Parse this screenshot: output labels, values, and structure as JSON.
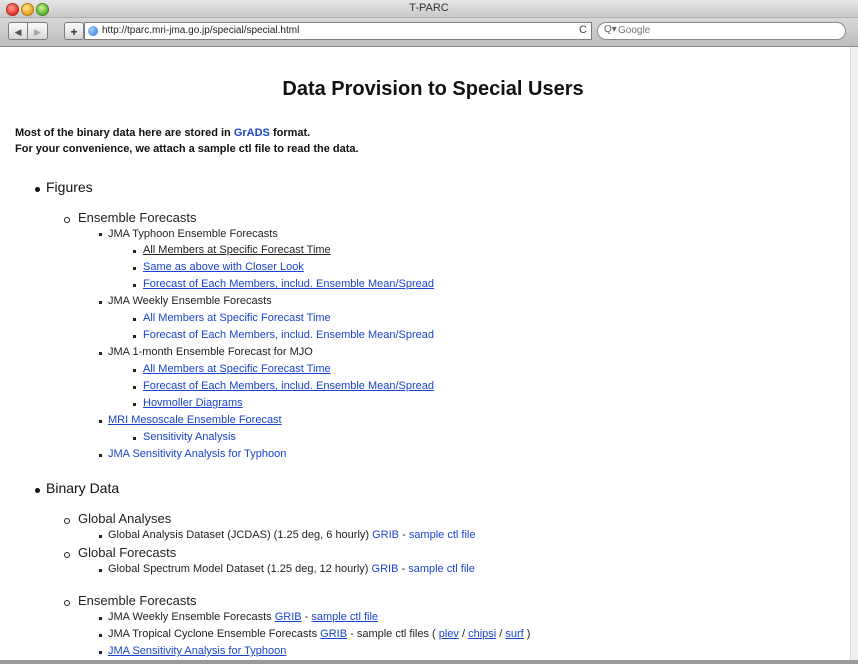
{
  "window": {
    "title": "T-PARC"
  },
  "toolbar": {
    "back_glyph": "◀",
    "forward_glyph": "▶",
    "add_glyph": "+",
    "url": "http://tparc.mri-jma.go.jp/special/special.html",
    "reload_glyph": "C",
    "search_placeholder": "Google",
    "search_glyph": "Q▾"
  },
  "page": {
    "title": "Data Provision to Special Users",
    "intro_pre": "Most of the binary data here are stored in ",
    "intro_link": "GrADS",
    "intro_post": " format.",
    "intro_line2": "For your convenience, we attach a sample ctl file to read the data.",
    "figures": {
      "heading": "Figures",
      "ensemble": "Ensemble Forecasts",
      "typhoon": "JMA Typhoon Ensemble Forecasts",
      "typhoon_links": [
        "All Members at Specific Forecast Time",
        "Same as above with Closer Look",
        "Forecast of Each Members, includ. Ensemble Mean/Spread"
      ],
      "weekly": "JMA Weekly Ensemble Forecasts",
      "weekly_links": [
        "All Members at Specific Forecast Time",
        "Forecast of Each Members, includ. Ensemble Mean/Spread"
      ],
      "month": "JMA 1-month Ensemble Forecast for MJO",
      "month_links": [
        "All Members at Specific Forecast Time",
        "Forecast of Each Members, includ. Ensemble Mean/Spread",
        "Hovmoller Diagrams"
      ],
      "mri": "MRI Mesoscale Ensemble Forecast",
      "mri_sub": "Sensitivity Analysis",
      "jma_sens": "JMA Sensitivity Analysis for Typhoon"
    },
    "binary": {
      "heading": "Binary Data",
      "global_analyses": "Global Analyses",
      "jcdas_text": "Global Analysis Dataset (JCDAS) (1.25 deg, 6 hourly) ",
      "global_forecasts": "Global Forecasts",
      "gsm_text": "Global Spectrum Model Dataset (1.25 deg, 12 hourly) ",
      "grib": "GRIB",
      "dash": " - ",
      "sample_ctl": "sample ctl file",
      "ensemble": "Ensemble Forecasts",
      "weekly_text": "JMA Weekly Ensemble Forecasts ",
      "tc_text": "JMA Tropical Cyclone Ensemble Forecasts ",
      "tc_mid": " - sample ctl files ( ",
      "plev": "plev",
      "slash": " / ",
      "chipsi": "chipsi",
      "surf": "surf",
      "close": " )",
      "jma_sens": "JMA Sensitivity Analysis for Typhoon"
    }
  }
}
